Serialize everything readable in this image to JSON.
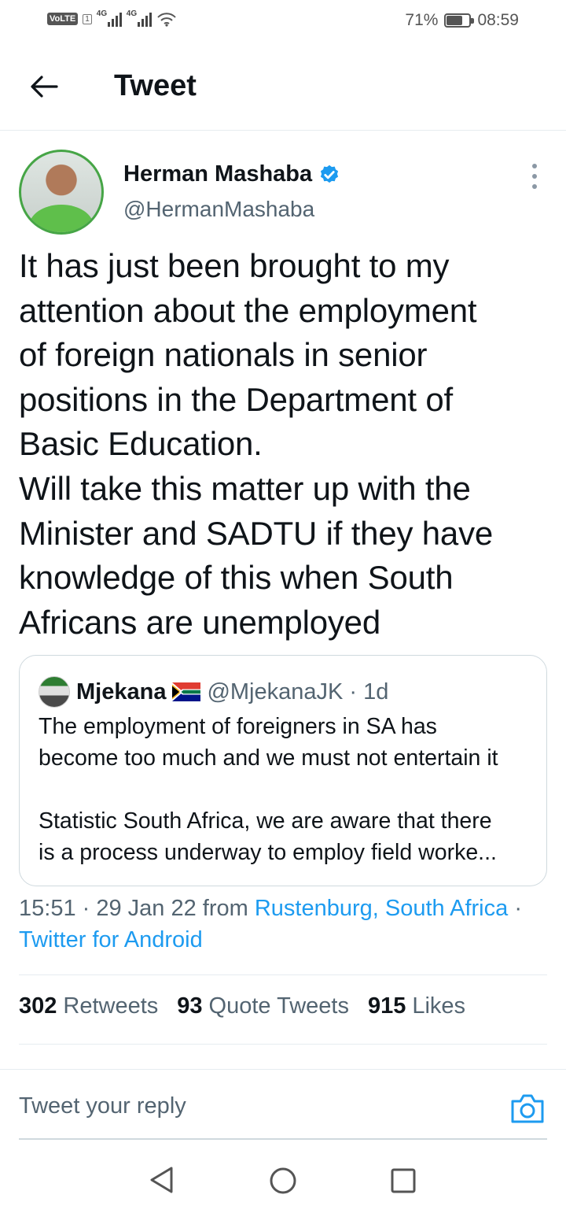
{
  "status_bar": {
    "volte": "VoLTE",
    "sim": "1",
    "network_1": "4G",
    "network_2": "4G",
    "battery": "71%",
    "battery_level": 0.71,
    "time": "08:59"
  },
  "header": {
    "title": "Tweet",
    "back_icon": "arrow-left-icon"
  },
  "tweet": {
    "author_name": "Herman Mashaba",
    "author_handle": "@HermanMashaba",
    "verified_icon": "verified-badge-icon",
    "text_lines": [
      "It has just been brought to my",
      "attention about the employment",
      "of foreign nationals in senior",
      "positions in the Department of",
      "Basic Education.",
      "Will take this matter up with the",
      "Minister and SADTU if they have",
      "knowledge of this when South",
      "Africans are unemployed"
    ],
    "time_date": "15:51 · 29 Jan 22 from ",
    "location": "Rustenburg, South Africa",
    "separator": " ·",
    "source": "Twitter for Android",
    "retweets_count": "302",
    "retweets_label": "Retweets",
    "quotes_count": "93",
    "quotes_label": "Quote Tweets",
    "likes_count": "915",
    "likes_label": "Likes"
  },
  "quote": {
    "name": "Mjekana",
    "flag_icon": "south-africa-flag-icon",
    "handle": "@MjekanaJK",
    "age": "· 1d",
    "line_1": "The employment of foreigners in SA has",
    "line_2": "become too much and we must not entertain it",
    "line_3": "Statistic South Africa, we are aware that there",
    "line_4": "is a process underway to employ field worke..."
  },
  "reply": {
    "placeholder": "Tweet your reply",
    "camera_icon": "camera-icon"
  },
  "colors": {
    "accent": "#1d9bf0",
    "text": "#0f1419",
    "secondary": "#536471",
    "border": "#cfd9de"
  }
}
